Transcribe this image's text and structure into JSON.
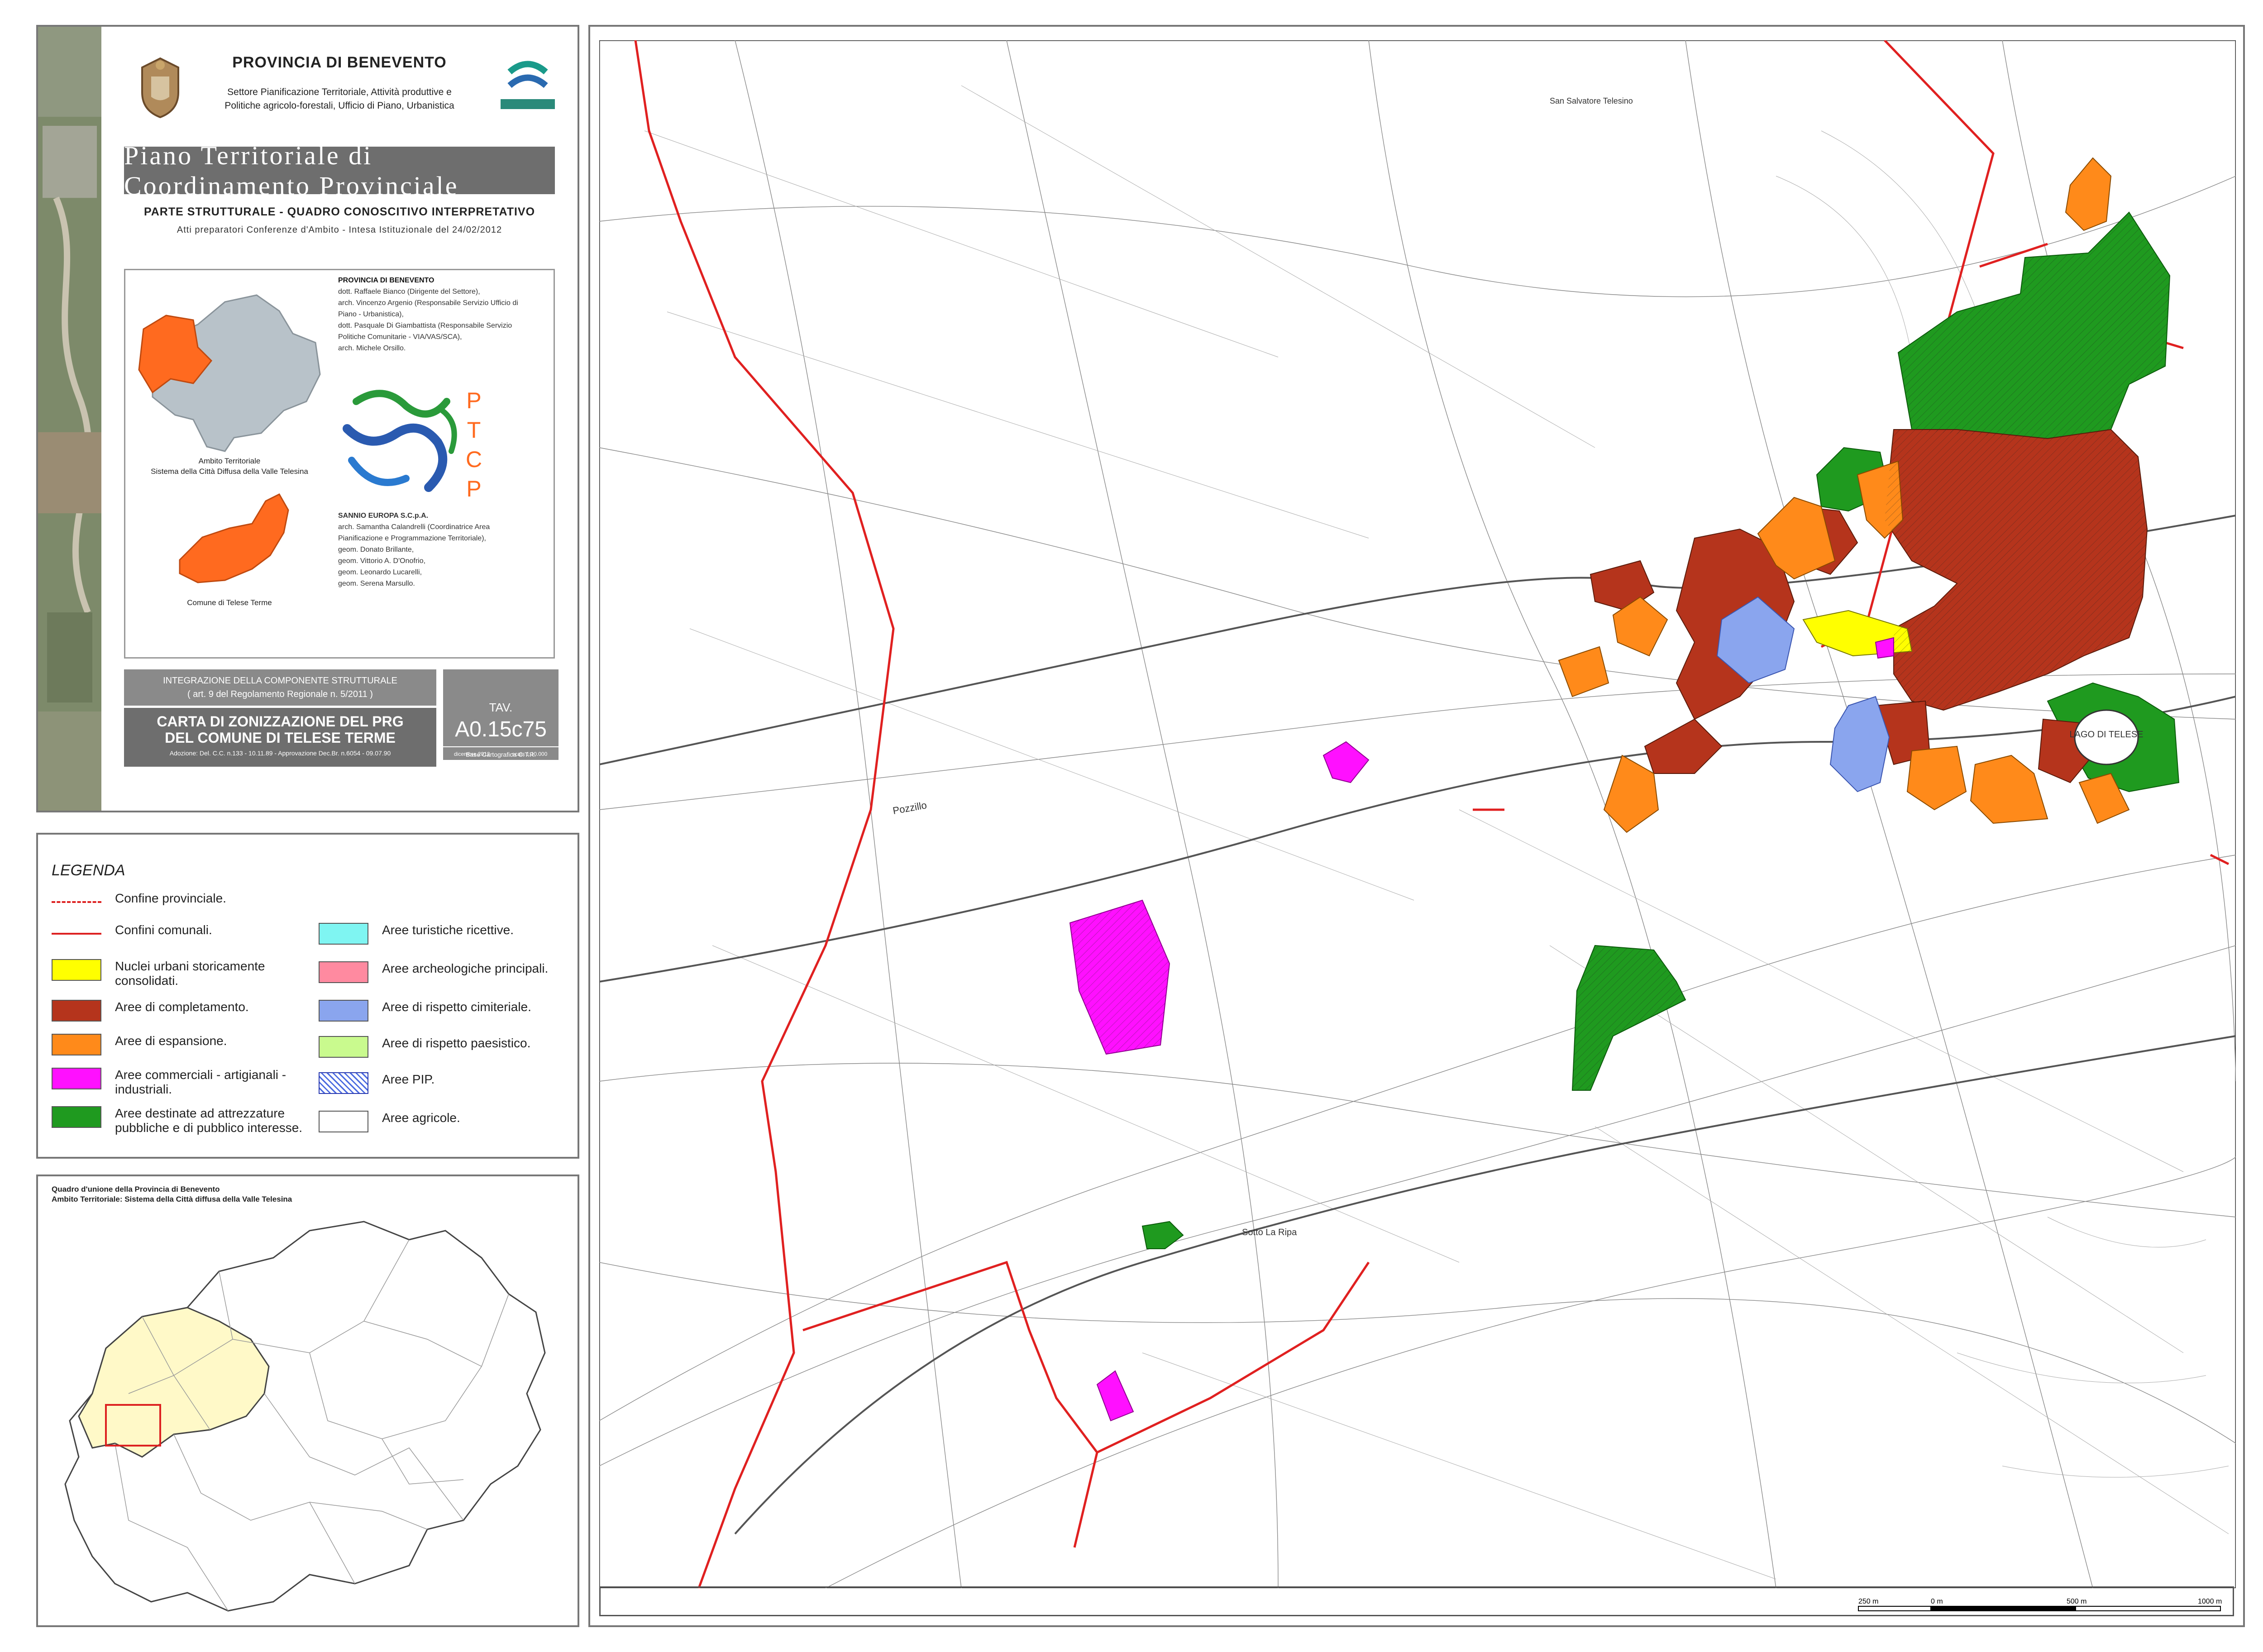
{
  "header": {
    "province": "PROVINCIA DI BENEVENTO",
    "sector": "Settore Pianificazione Territoriale, Attività produttive e Politiche agricolo-forestali, Ufficio di Piano, Urbanistica",
    "crest_caption": "PROVINCIA DI BENEVENTO",
    "partner_logo": "sannio europa"
  },
  "plan": {
    "title": "Piano Territoriale di Coordinamento Provinciale",
    "part": "PARTE STRUTTURALE - QUADRO CONOSCITIVO INTERPRETATIVO",
    "acts": "Atti preparatori Conferenze d'Ambito - Intesa Istituzionale del 24/02/2012"
  },
  "credits": {
    "province_label": "PROVINCIA DI BENEVENTO",
    "province_staff": [
      "dott. Raffaele Bianco (Dirigente del Settore),",
      "arch. Vincenzo Argenio (Responsabile Servizio Ufficio di",
      "Piano - Urbanistica),",
      "dott. Pasquale Di Giambattista (Responsabile Servizio",
      "Politiche Comunitarie - VIA/VAS/SCA),",
      "arch. Michele Orsillo."
    ],
    "sannio_label": "SANNIO EUROPA S.C.p.A.",
    "sannio_staff": [
      "arch. Samantha Calandrelli (Coordinatrice Area",
      "Pianificazione e Programmazione Territoriale),",
      "geom. Donato Brillante,",
      "geom. Vittorio A. D'Onofrio,",
      "geom. Leonardo Lucarelli,",
      "geom. Serena Marsullo."
    ],
    "ptcp_letters": [
      "P",
      "T",
      "C",
      "P"
    ]
  },
  "locator": {
    "ambito_caption_1": "Ambito Territoriale",
    "ambito_caption_2": "Sistema della Città Diffusa della Valle Telesina",
    "comune_caption": "Comune di Telese Terme"
  },
  "table_info": {
    "integration_1": "INTEGRAZIONE DELLA COMPONENTE STRUTTURALE",
    "integration_2": "( art. 9 del Regolamento Regionale n. 5/2011 )",
    "map_title_1": "CARTA DI ZONIZZAZIONE DEL PRG",
    "map_title_2": "DEL COMUNE DI TELESE TERME",
    "adoption": "Adozione: Del. C.C. n.133 - 10.11.89 - Approvazione Dec.Br. n.6054 - 09.07.90",
    "tav_prefix": "TAV.",
    "tav_code": "A0.15c75",
    "base": "Base Cartografica C.T.R.",
    "date": "dicembre 2012",
    "scale": "scala 1:10.000"
  },
  "legend": {
    "title": "LEGENDA",
    "boundaries": [
      {
        "label": "Confine provinciale.",
        "style": "dashed"
      },
      {
        "label": "Confini comunali.",
        "style": "solid"
      }
    ],
    "left": [
      {
        "label": "Nuclei urbani storicamente consolidati.",
        "color": "#ffff00"
      },
      {
        "label": "Aree di completamento.",
        "color": "#b5341c"
      },
      {
        "label": "Aree di espansione.",
        "color": "#ff8a1a"
      },
      {
        "label": "Aree commerciali - artigianali - industriali.",
        "color": "#ff10ff"
      },
      {
        "label": "Aree destinate ad attrezzature pubbliche e di pubblico interesse.",
        "color": "#1f9a1f"
      }
    ],
    "right": [
      {
        "label": "Aree turistiche ricettive.",
        "color": "#7ff5f2"
      },
      {
        "label": "Aree archeologiche principali.",
        "color": "#ff8aa0"
      },
      {
        "label": "Aree di rispetto cimiteriale.",
        "color": "#8aa5ee"
      },
      {
        "label": "Aree di rispetto paesistico.",
        "color": "#c9fa8e"
      },
      {
        "label": "Aree PIP.",
        "color": "#c8d6ff"
      },
      {
        "label": "Aree agricole.",
        "color": "#ffffff"
      }
    ]
  },
  "inset": {
    "title_1": "Quadro d'unione della Provincia di Benevento",
    "title_2": "Ambito Territoriale: Sistema della Città diffusa della Valle Telesina"
  },
  "map": {
    "place_labels": [
      "LAGO DI TELESE",
      "Sotto La Ripa",
      "Pozzillo",
      "San Salvatore Telesino"
    ],
    "scale_labels": [
      "250 m",
      "0 m",
      "500 m",
      "1000 m"
    ]
  }
}
